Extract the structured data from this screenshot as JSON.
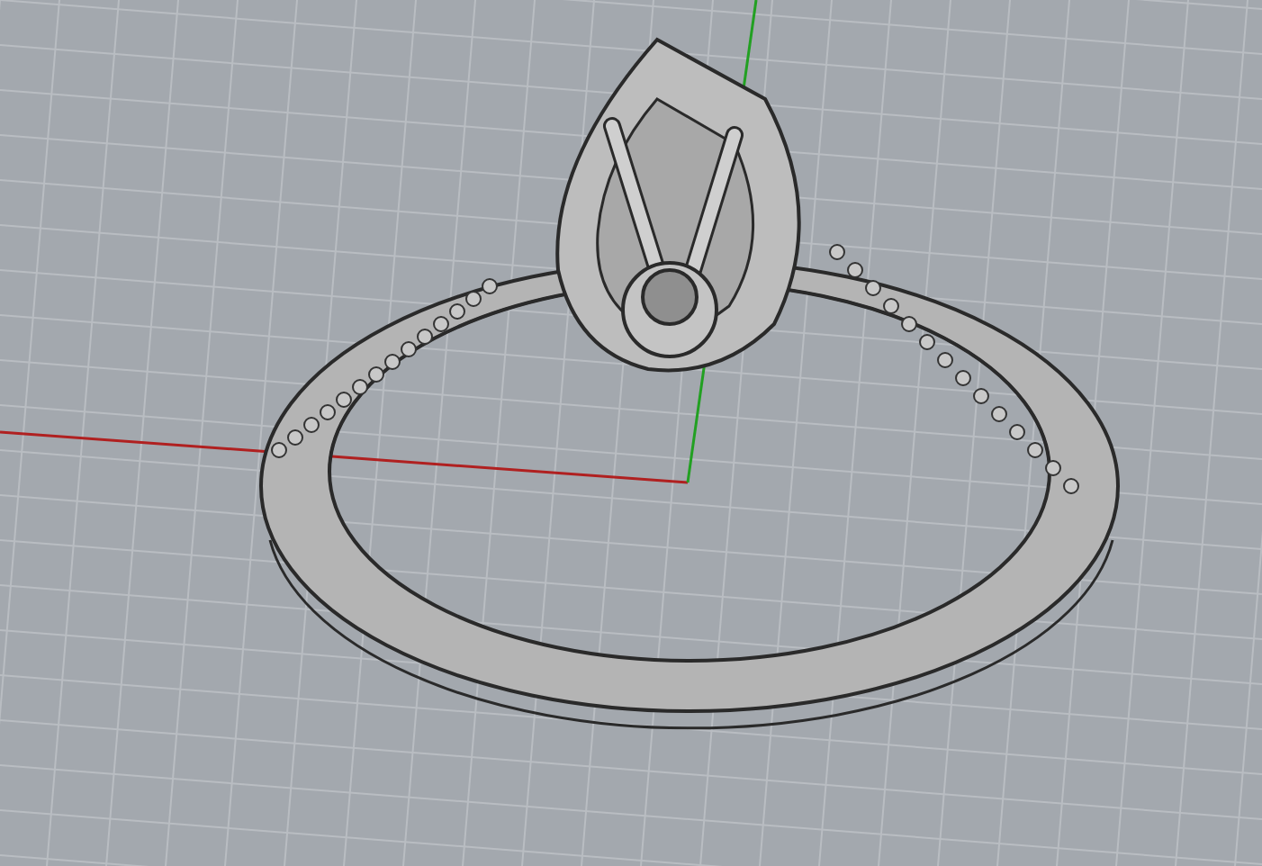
{
  "viewport": {
    "grid_visible": true,
    "axes_visible": true
  }
}
